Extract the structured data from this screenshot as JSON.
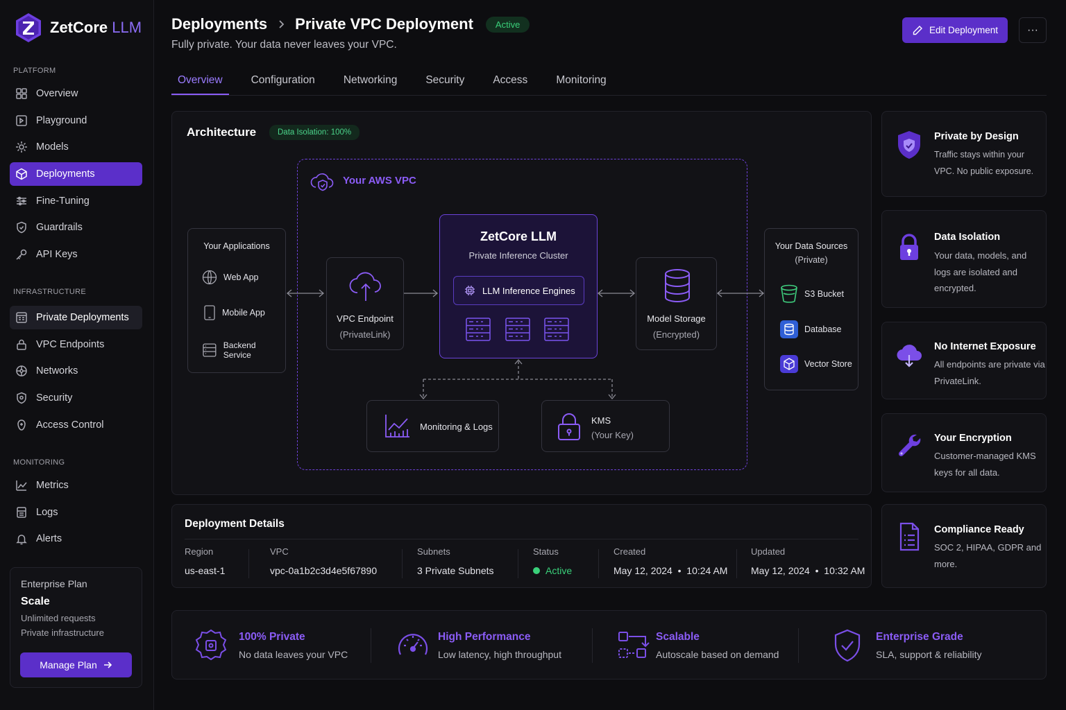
{
  "brand": {
    "name": "ZetCore",
    "suffix": "LLM"
  },
  "sidebar": {
    "platform_label": "PLATFORM",
    "platform": [
      {
        "label": "Overview",
        "icon": "overview-icon"
      },
      {
        "label": "Playground",
        "icon": "playground-icon"
      },
      {
        "label": "Models",
        "icon": "models-icon"
      },
      {
        "label": "Deployments",
        "icon": "deployments-icon"
      },
      {
        "label": "Fine-Tuning",
        "icon": "fine-tuning-icon"
      },
      {
        "label": "Guardrails",
        "icon": "guardrails-icon"
      },
      {
        "label": "API Keys",
        "icon": "key-icon"
      }
    ],
    "infra_label": "INFRASTRUCTURE",
    "infra": [
      {
        "label": "Private Deployments",
        "icon": "private-deployments-icon"
      },
      {
        "label": "VPC Endpoints",
        "icon": "vpc-endpoints-icon"
      },
      {
        "label": "Networks",
        "icon": "networks-icon"
      },
      {
        "label": "Security",
        "icon": "security-icon"
      },
      {
        "label": "Access Control",
        "icon": "access-control-icon"
      }
    ],
    "monitoring_label": "MONITORING",
    "monitoring": [
      {
        "label": "Metrics",
        "icon": "metrics-icon"
      },
      {
        "label": "Logs",
        "icon": "logs-icon"
      },
      {
        "label": "Alerts",
        "icon": "bell-icon"
      }
    ],
    "plan": {
      "title": "Enterprise Plan",
      "name": "Scale",
      "line1": "Unlimited requests",
      "line2": "Private infrastructure",
      "button": "Manage Plan"
    }
  },
  "header": {
    "crumb_root": "Deployments",
    "crumb_current": "Private VPC Deployment",
    "status": "Active",
    "subtitle": "Fully private. Your data never leaves your VPC.",
    "edit_button": "Edit Deployment",
    "more_button": "···"
  },
  "tabs": [
    "Overview",
    "Configuration",
    "Networking",
    "Security",
    "Access",
    "Monitoring"
  ],
  "architecture": {
    "title": "Architecture",
    "isolation_badge": "Data Isolation: 100%",
    "vpc_label": "Your AWS VPC",
    "apps": {
      "title": "Your Applications",
      "items": [
        "Web App",
        "Mobile App",
        "Backend Service"
      ]
    },
    "endpoint": {
      "title": "VPC Endpoint",
      "sub": "(PrivateLink)"
    },
    "cluster": {
      "title": "ZetCore LLM",
      "sub": "Private Inference Cluster",
      "engines": "LLM Inference Engines"
    },
    "storage": {
      "title": "Model Storage",
      "sub": "(Encrypted)"
    },
    "sources": {
      "title": "Your Data Sources",
      "sub": "(Private)",
      "items": [
        "S3 Bucket",
        "Database",
        "Vector Store"
      ]
    },
    "monitoring": "Monitoring & Logs",
    "kms": {
      "title": "KMS",
      "sub": "(Your Key)"
    }
  },
  "side_cards": [
    {
      "title": "Private by Design",
      "desc": "Traffic stays within your VPC. No public exposure.",
      "icon": "shield-icon"
    },
    {
      "title": "Data Isolation",
      "desc": "Your data, models, and logs are isolated and encrypted.",
      "icon": "lock-icon"
    },
    {
      "title": "No Internet Exposure",
      "desc": "All endpoints are private via PrivateLink.",
      "icon": "cloud-icon"
    },
    {
      "title": "Your Encryption",
      "desc": "Customer-managed KMS keys for all data.",
      "icon": "wrench-icon"
    },
    {
      "title": "Compliance Ready",
      "desc": "SOC 2, HIPAA, GDPR and more.",
      "icon": "document-icon"
    }
  ],
  "details": {
    "title": "Deployment Details",
    "fields": [
      {
        "key": "Region",
        "value": "us-east-1"
      },
      {
        "key": "VPC",
        "value": "vpc-0a1b2c3d4e5f67890"
      },
      {
        "key": "Subnets",
        "value": "3 Private Subnets"
      },
      {
        "key": "Status",
        "value": "Active"
      },
      {
        "key": "Created",
        "value": "May 12, 2024  •  10:24 AM"
      },
      {
        "key": "Updated",
        "value": "May 12, 2024  •  10:32 AM"
      }
    ]
  },
  "features": [
    {
      "title": "100% Private",
      "desc": "No data leaves your VPC",
      "icon": "private-chip-icon"
    },
    {
      "title": "High Performance",
      "desc": "Low latency, high throughput",
      "icon": "speedometer-icon"
    },
    {
      "title": "Scalable",
      "desc": "Autoscale based on demand",
      "icon": "scale-icon"
    },
    {
      "title": "Enterprise Grade",
      "desc": "SLA, support & reliability",
      "icon": "shield-check-icon"
    }
  ],
  "colors": {
    "accent": "#5b2fc9",
    "accent_text": "#8b5cf6",
    "success": "#3ad07a",
    "background": "#0d0d10"
  }
}
